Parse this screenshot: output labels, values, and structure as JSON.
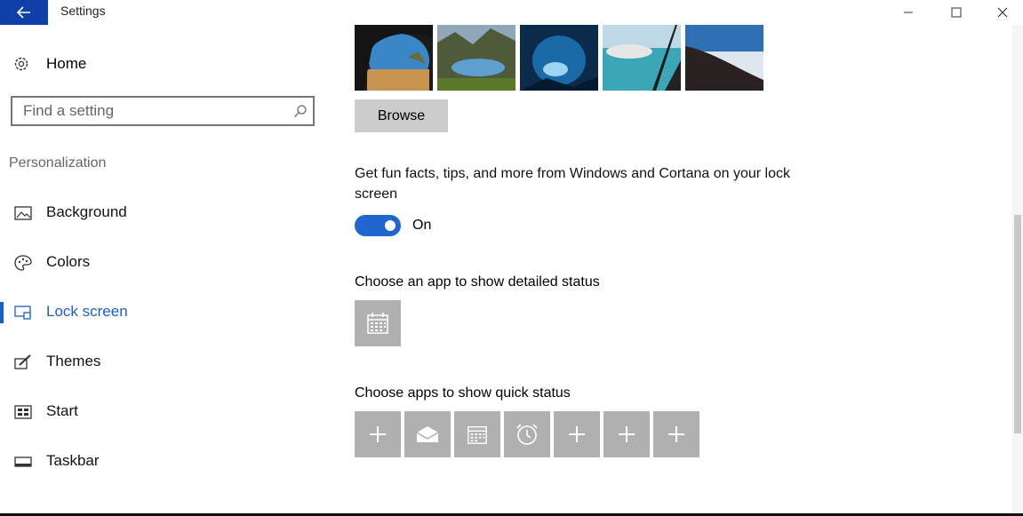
{
  "window": {
    "title": "Settings",
    "back_icon": "back-arrow-icon",
    "accent": "#1a5fc7",
    "controls": [
      "minimize",
      "maximize",
      "close"
    ]
  },
  "sidebar": {
    "home_label": "Home",
    "search_placeholder": "Find a setting",
    "section_title": "Personalization",
    "items": [
      {
        "label": "Background",
        "icon": "picture-icon",
        "active": false
      },
      {
        "label": "Colors",
        "icon": "palette-icon",
        "active": false
      },
      {
        "label": "Lock screen",
        "icon": "lock-screen-icon",
        "active": true
      },
      {
        "label": "Themes",
        "icon": "brush-icon",
        "active": false
      },
      {
        "label": "Start",
        "icon": "start-icon",
        "active": false
      },
      {
        "label": "Taskbar",
        "icon": "taskbar-icon",
        "active": false
      }
    ]
  },
  "main": {
    "browse_label": "Browse",
    "tips_text": "Get fun facts, tips, and more from Windows and Cortana on your lock screen",
    "toggle": {
      "state": "On",
      "on": true
    },
    "detailed_status_title": "Choose an app to show detailed status",
    "quick_status_title": "Choose apps to show quick status",
    "quick_apps": [
      "add-icon",
      "mail-icon",
      "calendar-icon",
      "alarm-icon",
      "add-icon",
      "add-icon",
      "add-icon"
    ]
  }
}
